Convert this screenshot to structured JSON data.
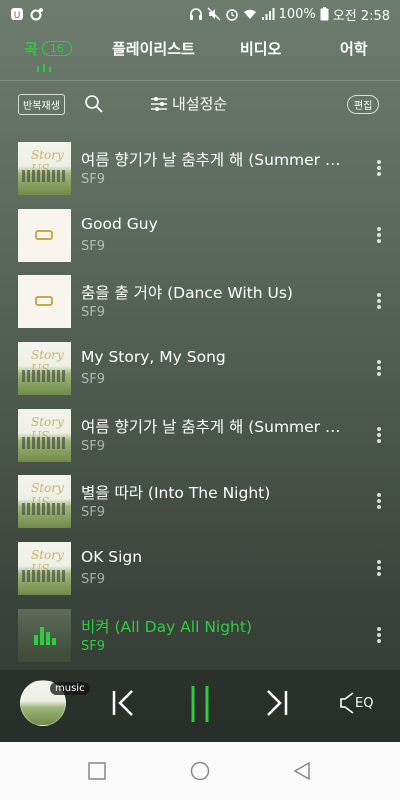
{
  "status_bar": {
    "battery": "100%",
    "time": "오전 2:58"
  },
  "tabs": [
    {
      "label": "곡",
      "count": "16",
      "active": true
    },
    {
      "label": "플레이리스트",
      "active": false
    },
    {
      "label": "비디오",
      "active": false
    },
    {
      "label": "어학",
      "active": false
    }
  ],
  "toolbar": {
    "repeat_label": "반복재생",
    "sort_label": "내설정순",
    "edit_label": "편집"
  },
  "songs": [
    {
      "title": "여름 향기가 날 춤추게 해 (Summer Breeze)",
      "artist": "SF9",
      "art": "story",
      "playing": false
    },
    {
      "title": "Good Guy",
      "artist": "SF9",
      "art": "white",
      "playing": false
    },
    {
      "title": "춤을 출 거야 (Dance With Us)",
      "artist": "SF9",
      "art": "white",
      "playing": false
    },
    {
      "title": "My Story, My Song",
      "artist": "SF9",
      "art": "story",
      "playing": false
    },
    {
      "title": "여름 향기가 날 춤추게 해 (Summer Breeze)",
      "artist": "SF9",
      "art": "story",
      "playing": false
    },
    {
      "title": "별을 따라 (Into The Night)",
      "artist": "SF9",
      "art": "story",
      "playing": false
    },
    {
      "title": "OK Sign",
      "artist": "SF9",
      "art": "story",
      "playing": false
    },
    {
      "title": "비켜 (All Day All Night)",
      "artist": "SF9",
      "art": "dim",
      "playing": true
    }
  ],
  "player": {
    "badge": "music",
    "eq_label": "EQ"
  },
  "album_art_text": "Story US",
  "colors": {
    "accent": "#2ecc40",
    "background": "#5a675b"
  }
}
